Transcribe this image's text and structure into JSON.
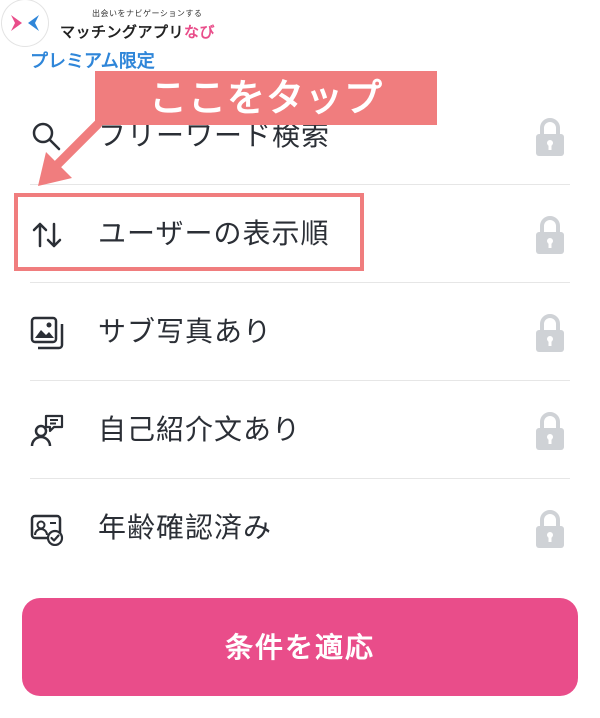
{
  "logo": {
    "tagline": "出会いをナビゲーションする",
    "name_main": "マッチングアプリ",
    "name_accent": "なび"
  },
  "premium_label": "プレミアム限定",
  "annotation": {
    "text": "ここをタップ"
  },
  "filters": [
    {
      "icon": "search-icon",
      "label": "フリーワード検索",
      "locked": true
    },
    {
      "icon": "sort-icon",
      "label": "ユーザーの表示順",
      "locked": true
    },
    {
      "icon": "gallery-icon",
      "label": "サブ写真あり",
      "locked": true
    },
    {
      "icon": "profile-chat-icon",
      "label": "自己紹介文あり",
      "locked": true
    },
    {
      "icon": "id-verified-icon",
      "label": "年齢確認済み",
      "locked": true
    }
  ],
  "apply_button": {
    "label": "条件を適応"
  },
  "colors": {
    "accent": "#e94d8a",
    "annotation": "#f07d7e",
    "premium": "#2f86d9",
    "lock": "#cfd2d6"
  }
}
